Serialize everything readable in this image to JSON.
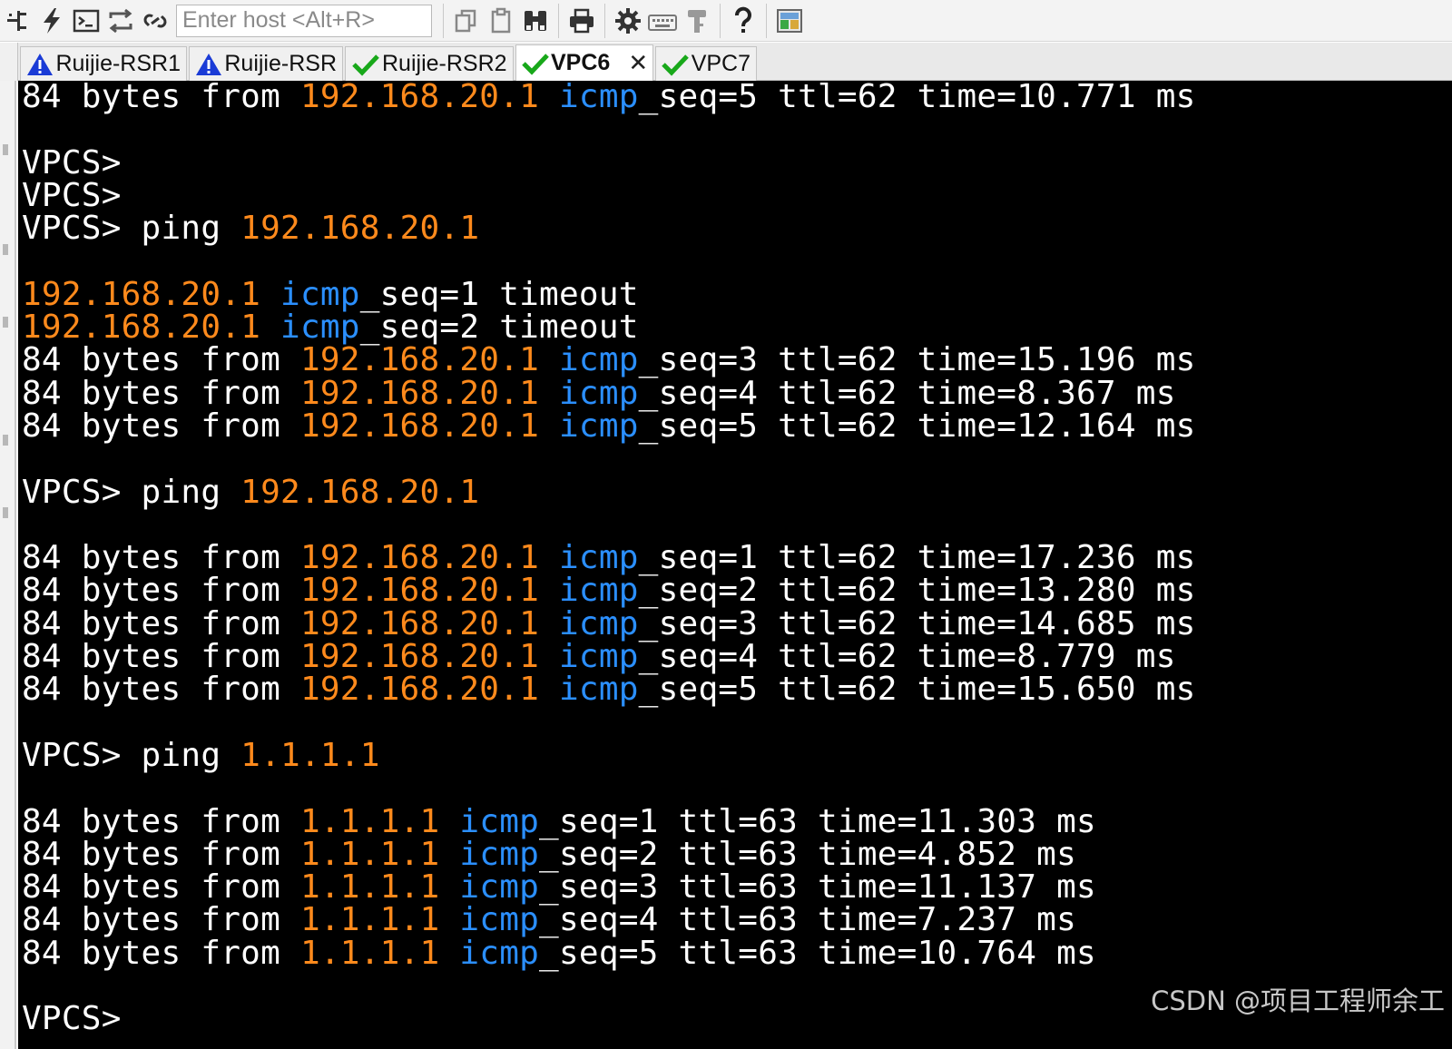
{
  "toolbar": {
    "buttons": [
      {
        "name": "connect-tree-icon",
        "title": "Sessions"
      },
      {
        "name": "quick-connect-icon",
        "title": "Quick Connect"
      },
      {
        "name": "terminal-icon",
        "title": "Connect in tab"
      },
      {
        "name": "reconnect-icon",
        "title": "Reconnect"
      },
      {
        "name": "disconnect-icon",
        "title": "Disconnect"
      }
    ],
    "host_placeholder": "Enter host <Alt+R>",
    "host_value": ""
  },
  "tabs": [
    {
      "label": "Ruijie-RSR1",
      "status": "warning",
      "active": false
    },
    {
      "label": "Ruijie-RSR",
      "status": "warning",
      "active": false
    },
    {
      "label": "Ruijie-RSR2",
      "status": "connected",
      "active": false
    },
    {
      "label": "VPC6",
      "status": "connected",
      "active": true,
      "close": "✕"
    },
    {
      "label": "VPC7",
      "status": "connected",
      "active": false
    }
  ],
  "colors": {
    "terminal_bg": "#000000",
    "text": "#ffffff",
    "ip": "#ff8a1c",
    "keyword": "#2b8fff",
    "warning": "#1a3bd6",
    "check": "#18a81a"
  },
  "terminal": {
    "lines": [
      {
        "segments": [
          {
            "t": "84 bytes from "
          },
          {
            "t": "192.168.20.1",
            "c": "ip"
          },
          {
            "t": " "
          },
          {
            "t": "icmp",
            "c": "kw"
          },
          {
            "t": "_seq=5 ttl=62 time=10.771 ms"
          }
        ]
      },
      {
        "segments": []
      },
      {
        "segments": [
          {
            "t": "VPCS>"
          }
        ]
      },
      {
        "segments": [
          {
            "t": "VPCS>"
          }
        ]
      },
      {
        "segments": [
          {
            "t": "VPCS> ping "
          },
          {
            "t": "192.168.20.1",
            "c": "ip"
          }
        ]
      },
      {
        "segments": []
      },
      {
        "segments": [
          {
            "t": "192.168.20.1",
            "c": "ip"
          },
          {
            "t": " "
          },
          {
            "t": "icmp",
            "c": "kw"
          },
          {
            "t": "_seq=1 timeout"
          }
        ]
      },
      {
        "segments": [
          {
            "t": "192.168.20.1",
            "c": "ip"
          },
          {
            "t": " "
          },
          {
            "t": "icmp",
            "c": "kw"
          },
          {
            "t": "_seq=2 timeout"
          }
        ]
      },
      {
        "segments": [
          {
            "t": "84 bytes from "
          },
          {
            "t": "192.168.20.1",
            "c": "ip"
          },
          {
            "t": " "
          },
          {
            "t": "icmp",
            "c": "kw"
          },
          {
            "t": "_seq=3 ttl=62 time=15.196 ms"
          }
        ]
      },
      {
        "segments": [
          {
            "t": "84 bytes from "
          },
          {
            "t": "192.168.20.1",
            "c": "ip"
          },
          {
            "t": " "
          },
          {
            "t": "icmp",
            "c": "kw"
          },
          {
            "t": "_seq=4 ttl=62 time=8.367 ms"
          }
        ]
      },
      {
        "segments": [
          {
            "t": "84 bytes from "
          },
          {
            "t": "192.168.20.1",
            "c": "ip"
          },
          {
            "t": " "
          },
          {
            "t": "icmp",
            "c": "kw"
          },
          {
            "t": "_seq=5 ttl=62 time=12.164 ms"
          }
        ]
      },
      {
        "segments": []
      },
      {
        "segments": [
          {
            "t": "VPCS> ping "
          },
          {
            "t": "192.168.20.1",
            "c": "ip"
          }
        ]
      },
      {
        "segments": []
      },
      {
        "segments": [
          {
            "t": "84 bytes from "
          },
          {
            "t": "192.168.20.1",
            "c": "ip"
          },
          {
            "t": " "
          },
          {
            "t": "icmp",
            "c": "kw"
          },
          {
            "t": "_seq=1 ttl=62 time=17.236 ms"
          }
        ]
      },
      {
        "segments": [
          {
            "t": "84 bytes from "
          },
          {
            "t": "192.168.20.1",
            "c": "ip"
          },
          {
            "t": " "
          },
          {
            "t": "icmp",
            "c": "kw"
          },
          {
            "t": "_seq=2 ttl=62 time=13.280 ms"
          }
        ]
      },
      {
        "segments": [
          {
            "t": "84 bytes from "
          },
          {
            "t": "192.168.20.1",
            "c": "ip"
          },
          {
            "t": " "
          },
          {
            "t": "icmp",
            "c": "kw"
          },
          {
            "t": "_seq=3 ttl=62 time=14.685 ms"
          }
        ]
      },
      {
        "segments": [
          {
            "t": "84 bytes from "
          },
          {
            "t": "192.168.20.1",
            "c": "ip"
          },
          {
            "t": " "
          },
          {
            "t": "icmp",
            "c": "kw"
          },
          {
            "t": "_seq=4 ttl=62 time=8.779 ms"
          }
        ]
      },
      {
        "segments": [
          {
            "t": "84 bytes from "
          },
          {
            "t": "192.168.20.1",
            "c": "ip"
          },
          {
            "t": " "
          },
          {
            "t": "icmp",
            "c": "kw"
          },
          {
            "t": "_seq=5 ttl=62 time=15.650 ms"
          }
        ]
      },
      {
        "segments": []
      },
      {
        "segments": [
          {
            "t": "VPCS> ping "
          },
          {
            "t": "1.1.1.1",
            "c": "ip"
          }
        ]
      },
      {
        "segments": []
      },
      {
        "segments": [
          {
            "t": "84 bytes from "
          },
          {
            "t": "1.1.1.1",
            "c": "ip"
          },
          {
            "t": " "
          },
          {
            "t": "icmp",
            "c": "kw"
          },
          {
            "t": "_seq=1 ttl=63 time=11.303 ms"
          }
        ]
      },
      {
        "segments": [
          {
            "t": "84 bytes from "
          },
          {
            "t": "1.1.1.1",
            "c": "ip"
          },
          {
            "t": " "
          },
          {
            "t": "icmp",
            "c": "kw"
          },
          {
            "t": "_seq=2 ttl=63 time=4.852 ms"
          }
        ]
      },
      {
        "segments": [
          {
            "t": "84 bytes from "
          },
          {
            "t": "1.1.1.1",
            "c": "ip"
          },
          {
            "t": " "
          },
          {
            "t": "icmp",
            "c": "kw"
          },
          {
            "t": "_seq=3 ttl=63 time=11.137 ms"
          }
        ]
      },
      {
        "segments": [
          {
            "t": "84 bytes from "
          },
          {
            "t": "1.1.1.1",
            "c": "ip"
          },
          {
            "t": " "
          },
          {
            "t": "icmp",
            "c": "kw"
          },
          {
            "t": "_seq=4 ttl=63 time=7.237 ms"
          }
        ]
      },
      {
        "segments": [
          {
            "t": "84 bytes from "
          },
          {
            "t": "1.1.1.1",
            "c": "ip"
          },
          {
            "t": " "
          },
          {
            "t": "icmp",
            "c": "kw"
          },
          {
            "t": "_seq=5 ttl=63 time=10.764 ms"
          }
        ]
      },
      {
        "segments": []
      },
      {
        "segments": [
          {
            "t": "VPCS>"
          }
        ]
      }
    ]
  },
  "watermark": "CSDN @项目工程师余工"
}
